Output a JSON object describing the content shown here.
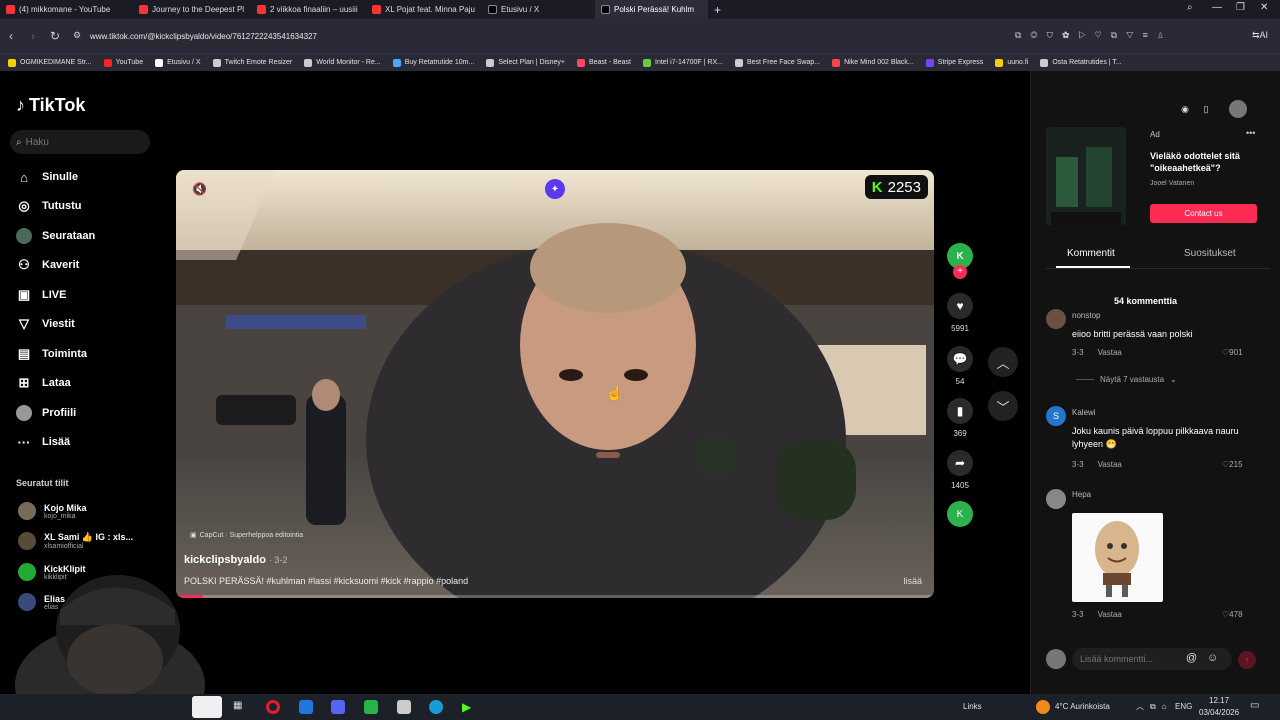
{
  "browser": {
    "tabs": [
      {
        "label": "(4) mikkomane - YouTube",
        "color": "#ff3333"
      },
      {
        "label": "Journey to the Deepest Pl",
        "color": "#ff3333"
      },
      {
        "label": "2 viikkoa finaaliin – uusiii",
        "color": "#ff3333"
      },
      {
        "label": "XL Pojat feat. Minna Paju",
        "color": "#ff3333"
      },
      {
        "label": "Etusivu / X",
        "color": "#ffffff"
      },
      {
        "label": "Polski Perässä! Kuhlm",
        "color": "#ffffff"
      }
    ],
    "active_tab_index": 5,
    "url": "www.tiktok.com/@kickclipsbyaldo/video/7612722243541634327",
    "ai_label": "AI",
    "bookmarks": [
      {
        "label": "OGMIKEDIMANE Str...",
        "color": "#f5d000"
      },
      {
        "label": "YouTube",
        "color": "#ff2222"
      },
      {
        "label": "Etusivu / X",
        "color": "#ffffff"
      },
      {
        "label": "Twitch Emote Resizer",
        "color": "#cccccc"
      },
      {
        "label": "World Monitor - Re...",
        "color": "#cccccc"
      },
      {
        "label": "Buy Retatrutide 10m...",
        "color": "#44aaff"
      },
      {
        "label": "Select Plan | Disney+",
        "color": "#cccccc"
      },
      {
        "label": "Beast - Beast",
        "color": "#ff4466"
      },
      {
        "label": "Intel i7-14700F | RX...",
        "color": "#66cc44"
      },
      {
        "label": "Best Free Face Swap...",
        "color": "#cccccc"
      },
      {
        "label": "Nike Mind 002 Black...",
        "color": "#ff4444"
      },
      {
        "label": "Stripe Express",
        "color": "#7744ff"
      },
      {
        "label": "uuno.fi",
        "color": "#ffcc00"
      },
      {
        "label": "Osta Retatrutides | T...",
        "color": "#cccccc"
      }
    ]
  },
  "tiktok": {
    "logo": "TikTok",
    "search_placeholder": "Haku",
    "nav": [
      {
        "label": "Sinulle",
        "icon": "home-icon"
      },
      {
        "label": "Tutustu",
        "icon": "compass-icon"
      },
      {
        "label": "Seurataan",
        "icon": "following-icon"
      },
      {
        "label": "Kaverit",
        "icon": "friends-icon"
      },
      {
        "label": "LIVE",
        "icon": "live-icon"
      },
      {
        "label": "Viestit",
        "icon": "messages-icon"
      },
      {
        "label": "Toiminta",
        "icon": "activity-icon"
      },
      {
        "label": "Lataa",
        "icon": "upload-icon"
      },
      {
        "label": "Profiili",
        "icon": "profile-icon"
      },
      {
        "label": "Lisää",
        "icon": "more-icon"
      }
    ],
    "followed_title": "Seuratut tilit",
    "followed": [
      {
        "name": "Kojo Mika",
        "handle": "kojo_mika"
      },
      {
        "name": "XL Sami 👍 IG : xls...",
        "handle": "xlsamiofficial"
      },
      {
        "name": "KickKlipit",
        "handle": "kikklipit"
      },
      {
        "name": "Elias",
        "handle": "elias"
      }
    ]
  },
  "video": {
    "badge_value": "2253",
    "author": "kickclipsbyaldo",
    "date": "· 3-2",
    "caption": "POLSKI PERÄSSÄ! #kuhlman #lassi #kicksuomi #kick #rappio #poland",
    "more": "lisää",
    "capcut": "CapCut · Superhelppoa editointia",
    "progress": 0.035
  },
  "actions": {
    "likes": "5991",
    "comments": "54",
    "saves": "369",
    "shares": "1405"
  },
  "ad": {
    "tag": "Ad",
    "title": "Vieläkö odottelet sitä \"oikeaahetkeä\"?",
    "author": "Jooel Vatanen",
    "button": "Contact us"
  },
  "panel": {
    "tab_comments": "Kommentit",
    "tab_recommend": "Suositukset",
    "comment_count": "54 kommenttia",
    "comments": [
      {
        "user": "nonstop",
        "text": "eiioo britti perässä vaan polski",
        "date": "3-3",
        "reply": "Vastaa",
        "likes": "901"
      },
      {
        "user": "Kalewi",
        "text": "Joku kaunis päivä loppuu pilkkaava nauru lyhyeen 😁",
        "date": "3-3",
        "reply": "Vastaa",
        "likes": "215"
      },
      {
        "user": "Hepa",
        "text": "",
        "date": "3-3",
        "reply": "Vastaa",
        "likes": "478"
      }
    ],
    "view_replies": "Näytä 7 vastausta",
    "input_placeholder": "Lisää kommentti..."
  },
  "taskbar": {
    "links": "Links",
    "weather": "4°C  Aurinkoista",
    "lang": "ENG",
    "time": "12.17",
    "date": "03/04/2026"
  }
}
